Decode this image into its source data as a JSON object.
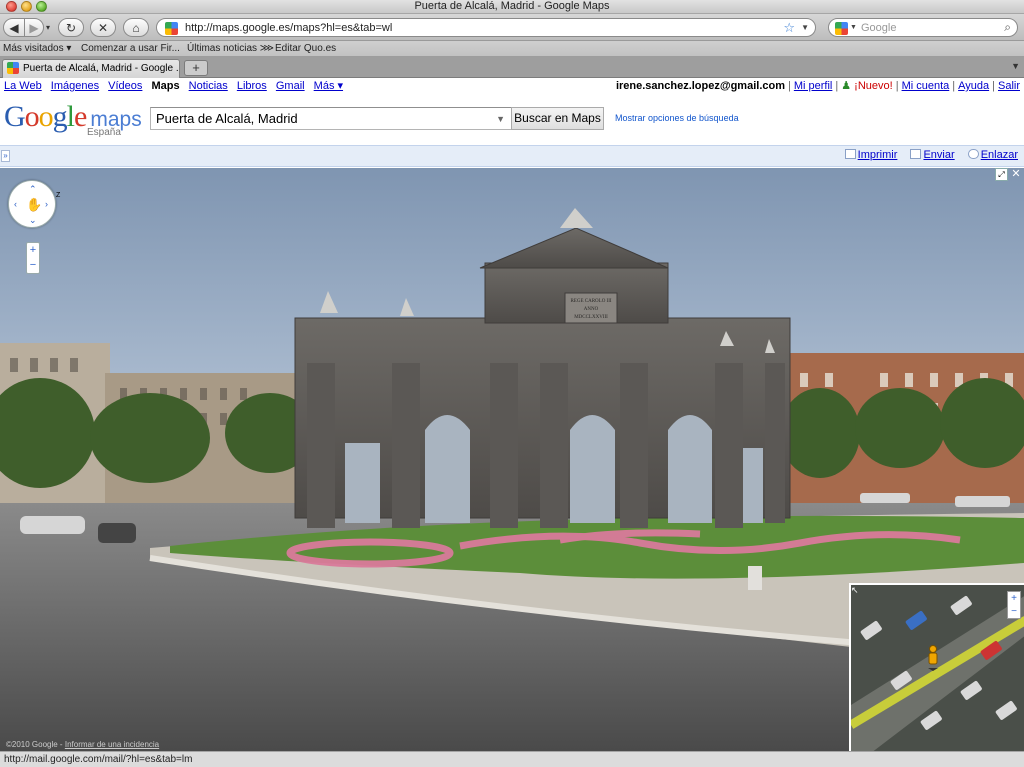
{
  "window": {
    "title": "Puerta de Alcalá, Madrid - Google Maps"
  },
  "navbar": {
    "url": "http://maps.google.es/maps?hl=es&tab=wl",
    "search_placeholder": "Google"
  },
  "bookmarks": [
    {
      "label": "Más visitados ▾"
    },
    {
      "label": "Comenzar a usar Fir..."
    },
    {
      "label": "Últimas noticias ⋙"
    },
    {
      "label": "Editar Quo.es"
    }
  ],
  "tabs": [
    {
      "label": "Puerta de Alcalá, Madrid - Google ..."
    }
  ],
  "gbar": {
    "left": [
      {
        "label": "La Web",
        "current": false
      },
      {
        "label": "Imágenes",
        "current": false
      },
      {
        "label": "Vídeos",
        "current": false
      },
      {
        "label": "Maps",
        "current": true
      },
      {
        "label": "Noticias",
        "current": false
      },
      {
        "label": "Libros",
        "current": false
      },
      {
        "label": "Gmail",
        "current": false
      },
      {
        "label": "Más ▾",
        "current": false
      }
    ],
    "user_email": "irene.sanchez.lopez@gmail.com",
    "profile": "Mi perfil",
    "nuevo": "¡Nuevo!",
    "account": "Mi cuenta",
    "help": "Ayuda",
    "signout": "Salir"
  },
  "logo": {
    "country": "España",
    "product": "maps"
  },
  "search": {
    "query": "Puerta de Alcalá, Madrid",
    "button": "Buscar en Maps",
    "options_link": "Mostrar opciones de búsqueda"
  },
  "toolbar": {
    "print": "Imprimir",
    "send": "Enviar",
    "link": "Enlazar"
  },
  "streetview": {
    "monument_inscription": [
      "REGE CAROLO III",
      "ANNO",
      "MDCCLXXVIII"
    ],
    "copyright": "©2010 Google -",
    "report": "Informar de una incidencia"
  },
  "statusbar": {
    "text": "http://mail.google.com/mail/?hl=es&tab=lm"
  },
  "colors": {
    "link": "#0000cc",
    "toolstrip_bg": "#e5edf8",
    "sky": "#9fb6cf",
    "grass": "#5c8e3a",
    "flowers": "#d97a9a"
  }
}
